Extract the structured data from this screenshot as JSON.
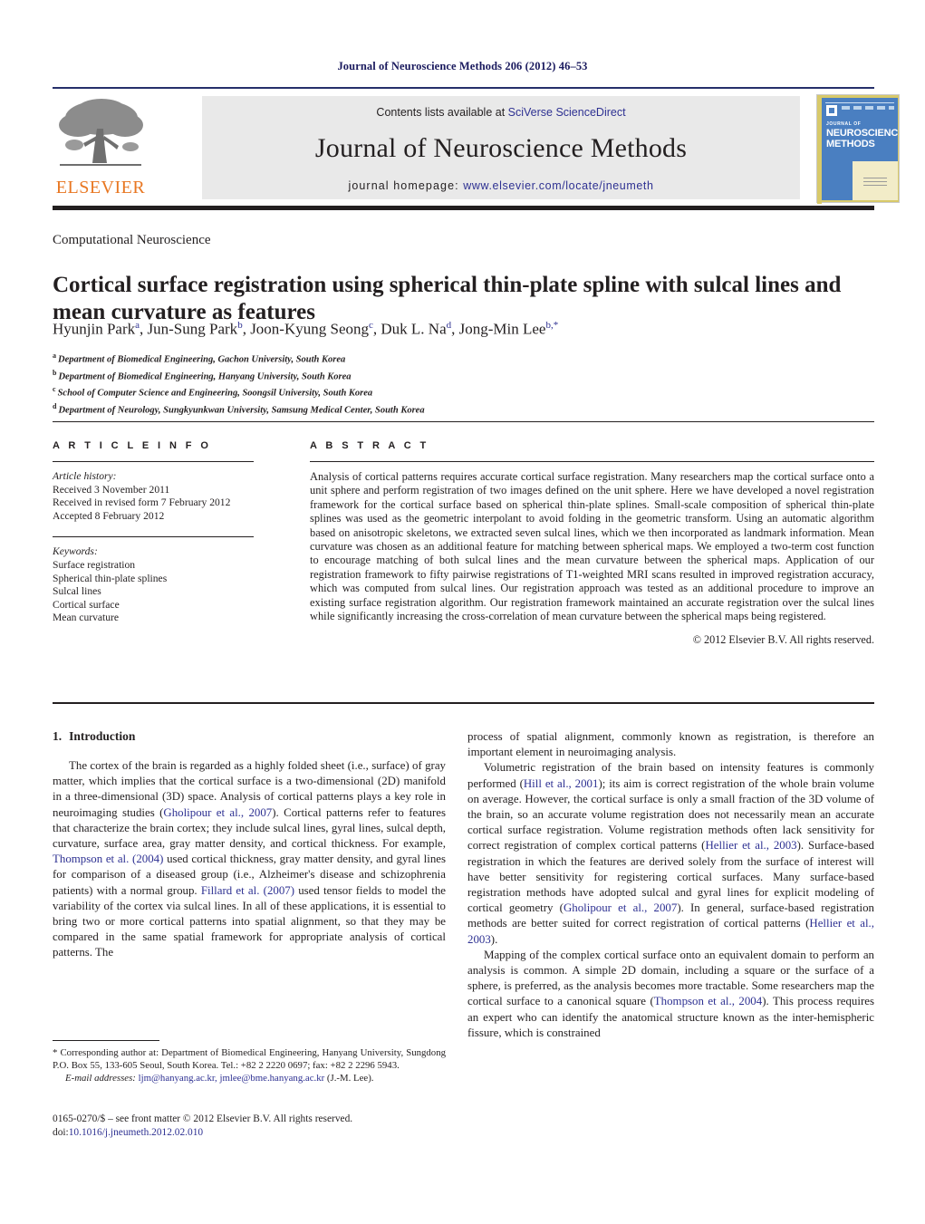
{
  "running_head": "Journal of Neuroscience Methods 206 (2012) 46–53",
  "masthead": {
    "contents_prefix": "Contents lists available at ",
    "sciencedirect_link": "SciVerse ScienceDirect",
    "journal_name": "Journal of Neuroscience Methods",
    "homepage_label": "journal homepage: ",
    "homepage_url": "www.elsevier.com/locate/jneumeth",
    "publisher_wordmark": "ELSEVIER",
    "cover": {
      "journal_of": "JOURNAL OF",
      "line1": "NEUROSCIENCE",
      "line2": "METHODS"
    },
    "colors": {
      "rule_blue": "#26306b",
      "link_blue": "#2e3192",
      "elsevier_orange": "#e87722",
      "banner_gray": "#e9e9e9",
      "cover_blue": "#4a7fc1",
      "cover_gold": "#d8c96a"
    }
  },
  "section_label": "Computational Neuroscience",
  "title": "Cortical surface registration using spherical thin-plate spline with sulcal lines and mean curvature as features",
  "authors": [
    {
      "name": "Hyunjin Park",
      "marks": "a"
    },
    {
      "name": "Jun-Sung Park",
      "marks": "b"
    },
    {
      "name": "Joon-Kyung Seong",
      "marks": "c"
    },
    {
      "name": "Duk L. Na",
      "marks": "d"
    },
    {
      "name": "Jong-Min Lee",
      "marks": "b,*"
    }
  ],
  "affiliations": [
    {
      "mark": "a",
      "text": "Department of Biomedical Engineering, Gachon University, South Korea"
    },
    {
      "mark": "b",
      "text": "Department of Biomedical Engineering, Hanyang University, South Korea"
    },
    {
      "mark": "c",
      "text": "School of Computer Science and Engineering, Soongsil University, South Korea"
    },
    {
      "mark": "d",
      "text": "Department of Neurology, Sungkyunkwan University, Samsung Medical Center, South Korea"
    }
  ],
  "article_info": {
    "heading": "A R T I C L E   I N F O",
    "history_label": "Article history:",
    "history": [
      "Received 3 November 2011",
      "Received in revised form 7 February 2012",
      "Accepted 8 February 2012"
    ],
    "keywords_label": "Keywords:",
    "keywords": [
      "Surface registration",
      "Spherical thin-plate splines",
      "Sulcal lines",
      "Cortical surface",
      "Mean curvature"
    ]
  },
  "abstract": {
    "heading": "A B S T R A C T",
    "text": "Analysis of cortical patterns requires accurate cortical surface registration. Many researchers map the cortical surface onto a unit sphere and perform registration of two images defined on the unit sphere. Here we have developed a novel registration framework for the cortical surface based on spherical thin-plate splines. Small-scale composition of spherical thin-plate splines was used as the geometric interpolant to avoid folding in the geometric transform. Using an automatic algorithm based on anisotropic skeletons, we extracted seven sulcal lines, which we then incorporated as landmark information. Mean curvature was chosen as an additional feature for matching between spherical maps. We employed a two-term cost function to encourage matching of both sulcal lines and the mean curvature between the spherical maps. Application of our registration framework to fifty pairwise registrations of T1-weighted MRI scans resulted in improved registration accuracy, which was computed from sulcal lines. Our registration approach was tested as an additional procedure to improve an existing surface registration algorithm. Our registration framework maintained an accurate registration over the sulcal lines while significantly increasing the cross-correlation of mean curvature between the spherical maps being registered.",
    "copyright": "© 2012 Elsevier B.V. All rights reserved."
  },
  "body": {
    "intro_number": "1.",
    "intro_title": "Introduction",
    "left_paragraphs": [
      {
        "segments": [
          {
            "t": "The cortex of the brain is regarded as a highly folded sheet (i.e., surface) of gray matter, which implies that the cortical surface is a two-dimensional (2D) manifold in a three-dimensional (3D) space. Analysis of cortical patterns plays a key role in neuroimaging studies (",
            "c": false
          },
          {
            "t": "Gholipour et al., 2007",
            "c": true
          },
          {
            "t": "). Cortical patterns refer to features that characterize the brain cortex; they include sulcal lines, gyral lines, sulcal depth, curvature, surface area, gray matter density, and cortical thickness. For example, ",
            "c": false
          },
          {
            "t": "Thompson et al. (2004)",
            "c": true
          },
          {
            "t": " used cortical thickness, gray matter density, and gyral lines for comparison of a diseased group (i.e., Alzheimer's disease and schizophrenia patients) with a normal group. ",
            "c": false
          },
          {
            "t": "Fillard et al. (2007)",
            "c": true
          },
          {
            "t": " used tensor fields to model the variability of the cortex via sulcal lines. In all of these applications, it is essential to bring two or more cortical patterns into spatial alignment, so that they may be compared in the same spatial framework for appropriate analysis of cortical patterns. The",
            "c": false
          }
        ]
      }
    ],
    "right_paragraphs": [
      {
        "indent": false,
        "segments": [
          {
            "t": "process of spatial alignment, commonly known as registration, is therefore an important element in neuroimaging analysis.",
            "c": false
          }
        ]
      },
      {
        "indent": true,
        "segments": [
          {
            "t": "Volumetric registration of the brain based on intensity features is commonly performed (",
            "c": false
          },
          {
            "t": "Hill et al., 2001",
            "c": true
          },
          {
            "t": "); its aim is correct registration of the whole brain volume on average. However, the cortical surface is only a small fraction of the 3D volume of the brain, so an accurate volume registration does not necessarily mean an accurate cortical surface registration. Volume registration methods often lack sensitivity for correct registration of complex cortical patterns (",
            "c": false
          },
          {
            "t": "Hellier et al., 2003",
            "c": true
          },
          {
            "t": "). Surface-based registration in which the features are derived solely from the surface of interest will have better sensitivity for registering cortical surfaces. Many surface-based registration methods have adopted sulcal and gyral lines for explicit modeling of cortical geometry (",
            "c": false
          },
          {
            "t": "Gholipour et al., 2007",
            "c": true
          },
          {
            "t": "). In general, surface-based registration methods are better suited for correct registration of cortical patterns (",
            "c": false
          },
          {
            "t": "Hellier et al., 2003",
            "c": true
          },
          {
            "t": ").",
            "c": false
          }
        ]
      },
      {
        "indent": true,
        "segments": [
          {
            "t": "Mapping of the complex cortical surface onto an equivalent domain to perform an analysis is common. A simple 2D domain, including a square or the surface of a sphere, is preferred, as the analysis becomes more tractable. Some researchers map the cortical surface to a canonical square (",
            "c": false
          },
          {
            "t": "Thompson et al., 2004",
            "c": true
          },
          {
            "t": "). This process requires an expert who can identify the anatomical structure known as the inter-hemispheric fissure, which is constrained",
            "c": false
          }
        ]
      }
    ]
  },
  "footnotes": {
    "corresponding": "* Corresponding author at: Department of Biomedical Engineering, Hanyang University, Sungdong P.O. Box 55, 133-605 Seoul, South Korea. Tel.: +82 2 2220 0697; fax: +82 2 2296 5943.",
    "email_label": "E-mail addresses:",
    "emails": "ljm@hanyang.ac.kr, jmlee@bme.hanyang.ac.kr",
    "email_suffix": "(J.-M. Lee).",
    "issn_line": "0165-0270/$ – see front matter © 2012 Elsevier B.V. All rights reserved.",
    "doi_label": "doi:",
    "doi_value": "10.1016/j.jneumeth.2012.02.010"
  }
}
